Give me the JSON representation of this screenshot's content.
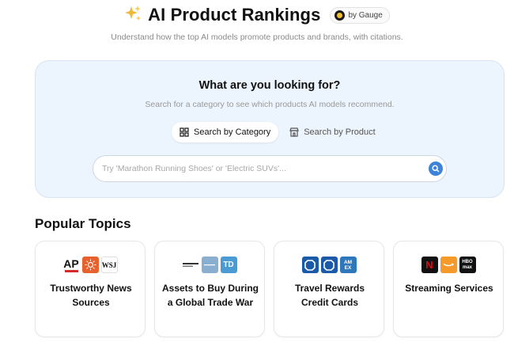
{
  "header": {
    "icon": "sparkle-icon",
    "title": "AI Product Rankings",
    "badge": {
      "icon": "gauge-logo-icon",
      "label": "by Gauge"
    }
  },
  "subtitle": "Understand how the top AI models promote products and brands, with citations.",
  "search": {
    "heading": "What are you looking for?",
    "subheading": "Search for a category to see which products AI models recommend.",
    "tabs": [
      {
        "label": "Search by Category",
        "icon": "grid-icon",
        "active": true
      },
      {
        "label": "Search by Product",
        "icon": "store-icon",
        "active": false
      }
    ],
    "placeholder": "Try 'Marathon Running Shoes' or 'Electric SUVs'...",
    "value": "",
    "button_icon": "search-icon"
  },
  "popular": {
    "title": "Popular Topics",
    "cards": [
      {
        "label": "Trustworthy News Sources",
        "logos": [
          {
            "name": "ap-logo-icon",
            "text": "AP"
          },
          {
            "name": "sunburst-logo-icon",
            "text": ""
          },
          {
            "name": "wsj-logo-icon",
            "text": "WSJ"
          }
        ]
      },
      {
        "label": "Assets to Buy During a Global Trade War",
        "logos": [
          {
            "name": "fund-logo-icon",
            "text": ""
          },
          {
            "name": "bank-logo-icon",
            "text": ""
          },
          {
            "name": "td-logo-icon",
            "text": "TD"
          }
        ]
      },
      {
        "label": "Travel Rewards Credit Cards",
        "logos": [
          {
            "name": "chase-logo-icon",
            "text": ""
          },
          {
            "name": "chase-logo-icon",
            "text": ""
          },
          {
            "name": "amex-logo-icon",
            "text": "AM EX"
          }
        ]
      },
      {
        "label": "Streaming Services",
        "logos": [
          {
            "name": "netflix-logo-icon",
            "text": "N"
          },
          {
            "name": "amazon-logo-icon",
            "text": ""
          },
          {
            "name": "hbo-max-logo-icon",
            "text": "HBO max"
          }
        ]
      }
    ]
  },
  "colors": {
    "panel_bg": "#ecf4fd",
    "accent": "#3d83d9",
    "ap_red": "#d42b2b",
    "sunburst_orange": "#e8602c",
    "td_green": "#4a9ad4",
    "chase_blue": "#1b5aa8",
    "amex_blue": "#2e77bc",
    "netflix_red": "#e50914",
    "amazon_orange": "#f59a2a"
  }
}
